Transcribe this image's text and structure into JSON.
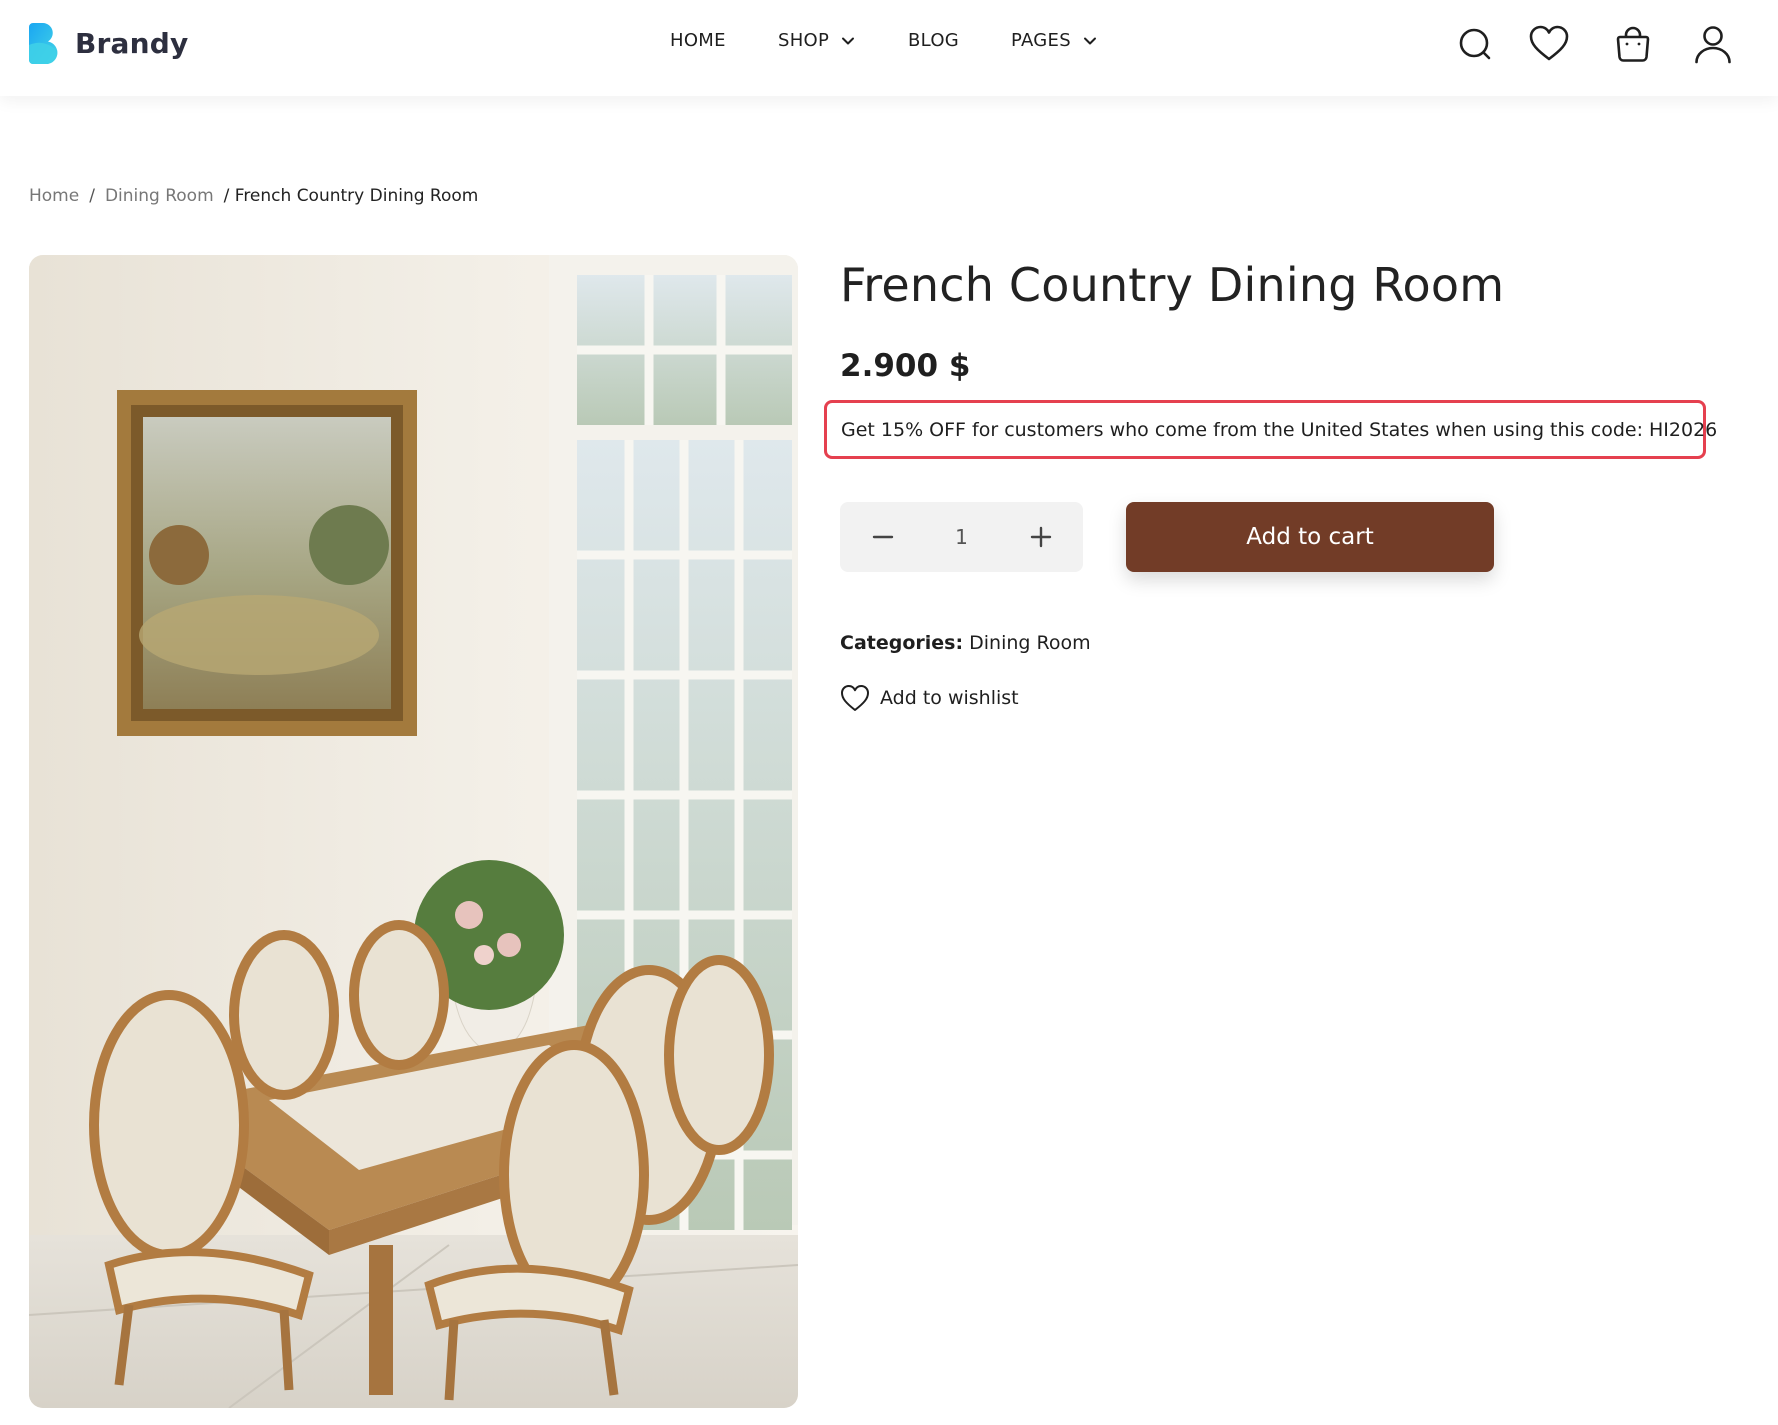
{
  "brand": {
    "name": "Brandy",
    "logo_colors": [
      "#1fb4f0",
      "#3fd1e8"
    ]
  },
  "nav": {
    "items": [
      {
        "label": "HOME",
        "has_dropdown": false
      },
      {
        "label": "SHOP",
        "has_dropdown": true
      },
      {
        "label": "BLOG",
        "has_dropdown": false
      },
      {
        "label": "PAGES",
        "has_dropdown": true
      }
    ]
  },
  "header_icons": [
    "search-icon",
    "heart-icon",
    "shopping-bag-icon",
    "user-icon"
  ],
  "breadcrumb": {
    "home": "Home",
    "separator": "/",
    "category": "Dining Room",
    "current": "/ French Country Dining Room"
  },
  "product": {
    "title": "French Country Dining Room",
    "price": "2.900 $",
    "promo": "Get 15% OFF for customers who come from the United States when using this code: HI2026",
    "quantity": "1",
    "add_to_cart_label": "Add to cart",
    "categories_label": "Categories:",
    "category_value": "Dining Room",
    "wishlist_label": "Add to wishlist"
  },
  "colors": {
    "accent_button": "#723c27",
    "promo_border": "#e5404f",
    "qty_bg": "#f2f2f2"
  }
}
